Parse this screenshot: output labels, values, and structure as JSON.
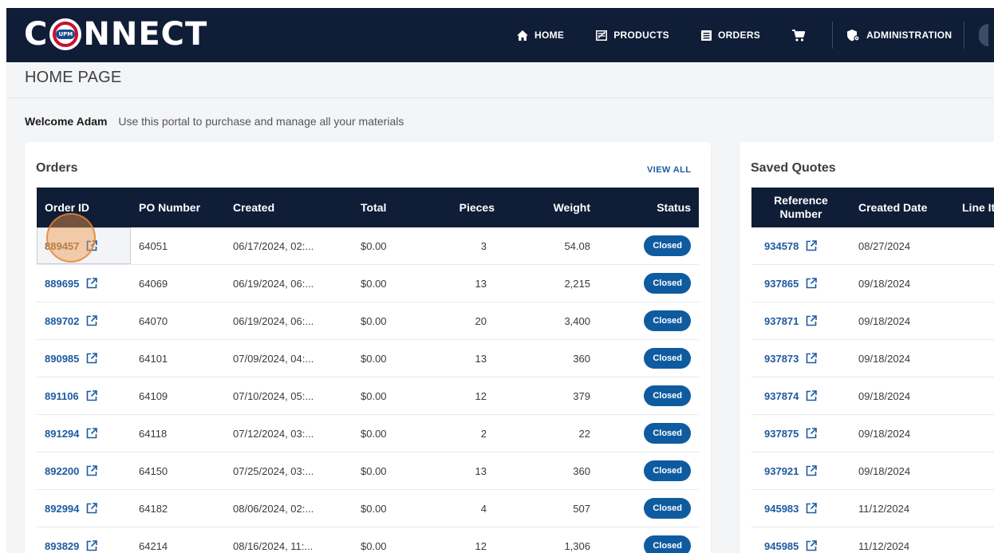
{
  "app": {
    "logo_text_left": "C",
    "logo_badge": "UPM",
    "logo_text_right": "NNECT"
  },
  "nav": {
    "home": "HOME",
    "products": "PRODUCTS",
    "orders": "ORDERS",
    "administration": "ADMINISTRATION"
  },
  "page": {
    "title": "HOME PAGE",
    "welcome_name": "Welcome Adam",
    "welcome_message": "Use this portal to purchase and manage all your materials"
  },
  "orders": {
    "title": "Orders",
    "view_all": "VIEW ALL",
    "columns": [
      "Order ID",
      "PO Number",
      "Created",
      "Total",
      "Pieces",
      "Weight",
      "Status"
    ],
    "rows": [
      {
        "id": "889457",
        "po": "64051",
        "created": "06/17/2024, 02:...",
        "total": "$0.00",
        "pieces": "3",
        "weight": "54.08",
        "status": "Closed"
      },
      {
        "id": "889695",
        "po": "64069",
        "created": "06/19/2024, 06:...",
        "total": "$0.00",
        "pieces": "13",
        "weight": "2,215",
        "status": "Closed"
      },
      {
        "id": "889702",
        "po": "64070",
        "created": "06/19/2024, 06:...",
        "total": "$0.00",
        "pieces": "20",
        "weight": "3,400",
        "status": "Closed"
      },
      {
        "id": "890985",
        "po": "64101",
        "created": "07/09/2024, 04:...",
        "total": "$0.00",
        "pieces": "13",
        "weight": "360",
        "status": "Closed"
      },
      {
        "id": "891106",
        "po": "64109",
        "created": "07/10/2024, 05:...",
        "total": "$0.00",
        "pieces": "12",
        "weight": "379",
        "status": "Closed"
      },
      {
        "id": "891294",
        "po": "64118",
        "created": "07/12/2024, 03:...",
        "total": "$0.00",
        "pieces": "2",
        "weight": "22",
        "status": "Closed"
      },
      {
        "id": "892200",
        "po": "64150",
        "created": "07/25/2024, 03:...",
        "total": "$0.00",
        "pieces": "13",
        "weight": "360",
        "status": "Closed"
      },
      {
        "id": "892994",
        "po": "64182",
        "created": "08/06/2024, 02:...",
        "total": "$0.00",
        "pieces": "4",
        "weight": "507",
        "status": "Closed"
      },
      {
        "id": "893829",
        "po": "64214",
        "created": "08/16/2024, 11:...",
        "total": "$0.00",
        "pieces": "12",
        "weight": "1,306",
        "status": "Closed"
      }
    ]
  },
  "quotes": {
    "title": "Saved Quotes",
    "columns": [
      "Reference Number",
      "Created Date",
      "Line It"
    ],
    "rows": [
      {
        "ref": "934578",
        "date": "08/27/2024"
      },
      {
        "ref": "937865",
        "date": "09/18/2024"
      },
      {
        "ref": "937871",
        "date": "09/18/2024"
      },
      {
        "ref": "937873",
        "date": "09/18/2024"
      },
      {
        "ref": "937874",
        "date": "09/18/2024"
      },
      {
        "ref": "937875",
        "date": "09/18/2024"
      },
      {
        "ref": "937921",
        "date": "09/18/2024"
      },
      {
        "ref": "945983",
        "date": "11/12/2024"
      },
      {
        "ref": "945985",
        "date": "11/12/2024"
      }
    ]
  },
  "colors": {
    "navy": "#0f1d37",
    "link_blue": "#1e5aa0",
    "badge_blue": "#0f5ba0",
    "accent_red": "#c8102e"
  }
}
